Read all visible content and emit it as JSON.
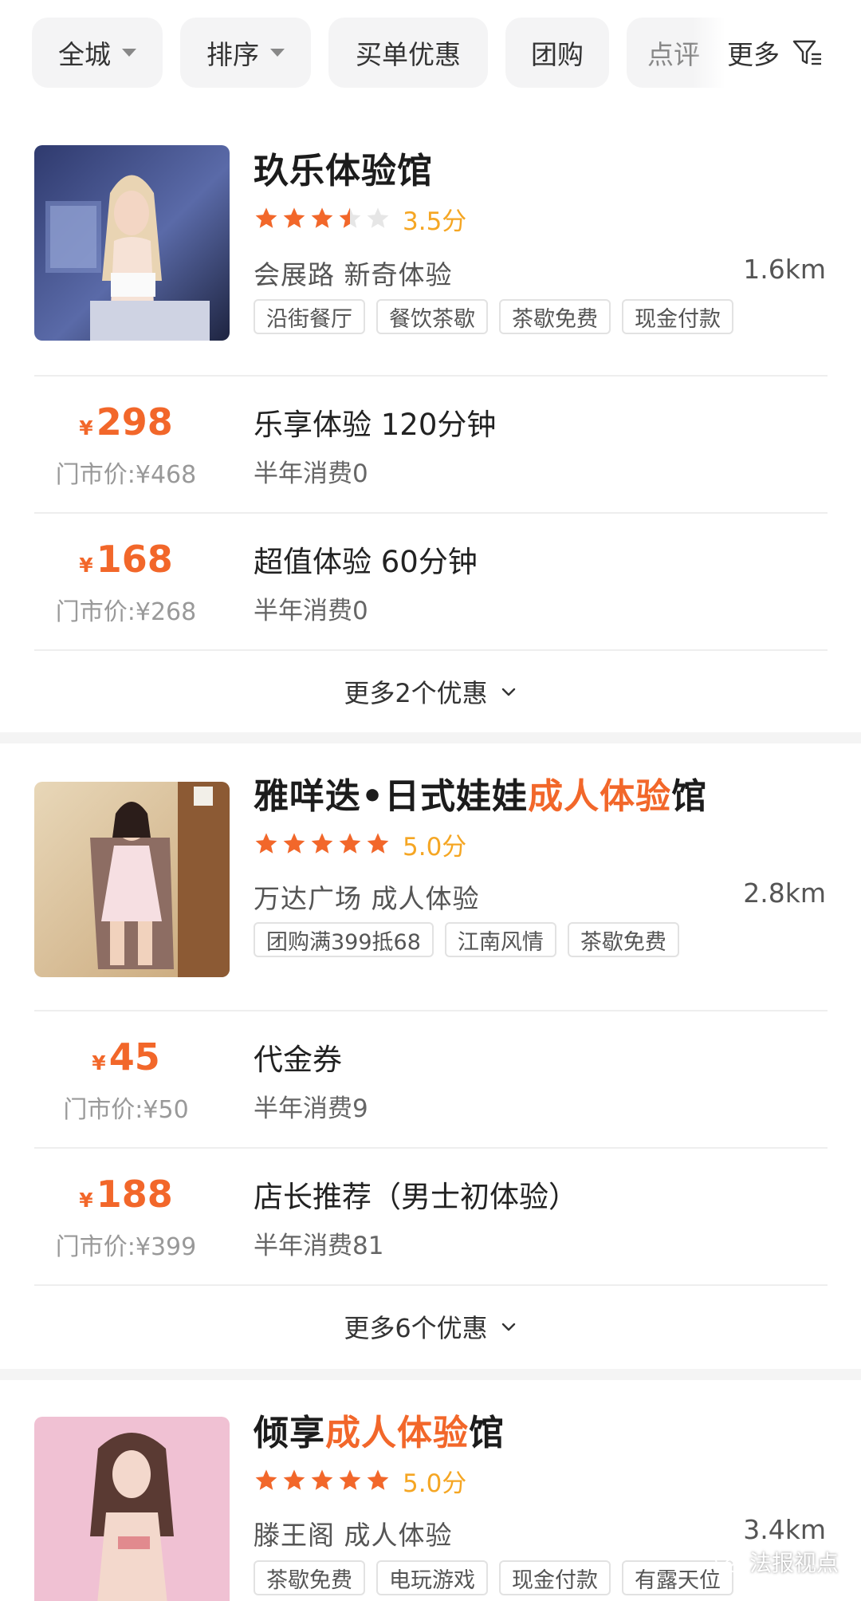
{
  "filters": {
    "chips": [
      "全城",
      "排序",
      "买单优惠",
      "团购",
      "点评"
    ],
    "more_label": "更多"
  },
  "shops": [
    {
      "name_parts": [
        "玖乐体验馆",
        "",
        ""
      ],
      "stars": 3.5,
      "score_text": "3.5分",
      "area": "会展路  新奇体验",
      "distance": "1.6km",
      "tags": [
        "沿街餐厅",
        "餐饮茶歇",
        "茶歇免费",
        "现金付款"
      ],
      "deals": [
        {
          "price": "298",
          "original": "门市价:¥468",
          "title": "乐享体验 120分钟",
          "sold": "半年消费0"
        },
        {
          "price": "168",
          "original": "门市价:¥268",
          "title": "超值体验 60分钟",
          "sold": "半年消费0"
        }
      ],
      "more_deals": "更多2个优惠"
    },
    {
      "name_parts": [
        "雅咩迭•日式娃娃",
        "成人体验",
        "馆"
      ],
      "stars": 5,
      "score_text": "5.0分",
      "area": "万达广场  成人体验",
      "distance": "2.8km",
      "tags": [
        "团购满399抵68",
        "江南风情",
        "茶歇免费"
      ],
      "deals": [
        {
          "price": "45",
          "original": "门市价:¥50",
          "title": "代金券",
          "sold": "半年消费9"
        },
        {
          "price": "188",
          "original": "门市价:¥399",
          "title": "店长推荐（男士初体验）",
          "sold": "半年消费81"
        }
      ],
      "more_deals": "更多6个优惠"
    },
    {
      "name_parts": [
        "倾享",
        "成人体验",
        "馆"
      ],
      "stars": 5,
      "score_text": "5.0分",
      "area": "滕王阁  成人体验",
      "distance": "3.4km",
      "tags": [
        "茶歇免费",
        "电玩游戏",
        "现金付款",
        "有露天位"
      ]
    }
  ],
  "watermark": "法报视点",
  "colors": {
    "accent": "#f2672a",
    "star": "#f2672a",
    "score": "#f5a623",
    "divider": "#f4f4f4"
  }
}
